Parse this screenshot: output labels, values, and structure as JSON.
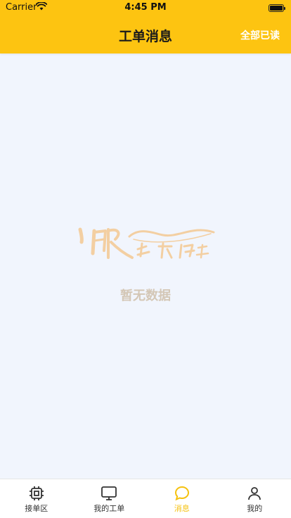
{
  "status_bar": {
    "carrier": "Carrier",
    "time": "4:45 PM",
    "battery_level": 1.0
  },
  "nav": {
    "title": "工单消息",
    "action_label": "全部已读"
  },
  "empty_state": {
    "logo_icon": "calligraphy-logo-icon",
    "message": "暂无数据"
  },
  "tabs": [
    {
      "label": "接单区",
      "icon": "chip-icon",
      "active": false
    },
    {
      "label": "我的工单",
      "icon": "monitor-icon",
      "active": false
    },
    {
      "label": "消息",
      "icon": "chat-bubble-icon",
      "active": true
    },
    {
      "label": "我的",
      "icon": "person-icon",
      "active": false
    }
  ],
  "colors": {
    "header": "#fdc411",
    "background": "#f1f5fd",
    "tab_active": "#f5c10d",
    "tab_inactive": "#333333",
    "empty_text": "#d4c7b6",
    "logo": "#f3cfa2"
  }
}
